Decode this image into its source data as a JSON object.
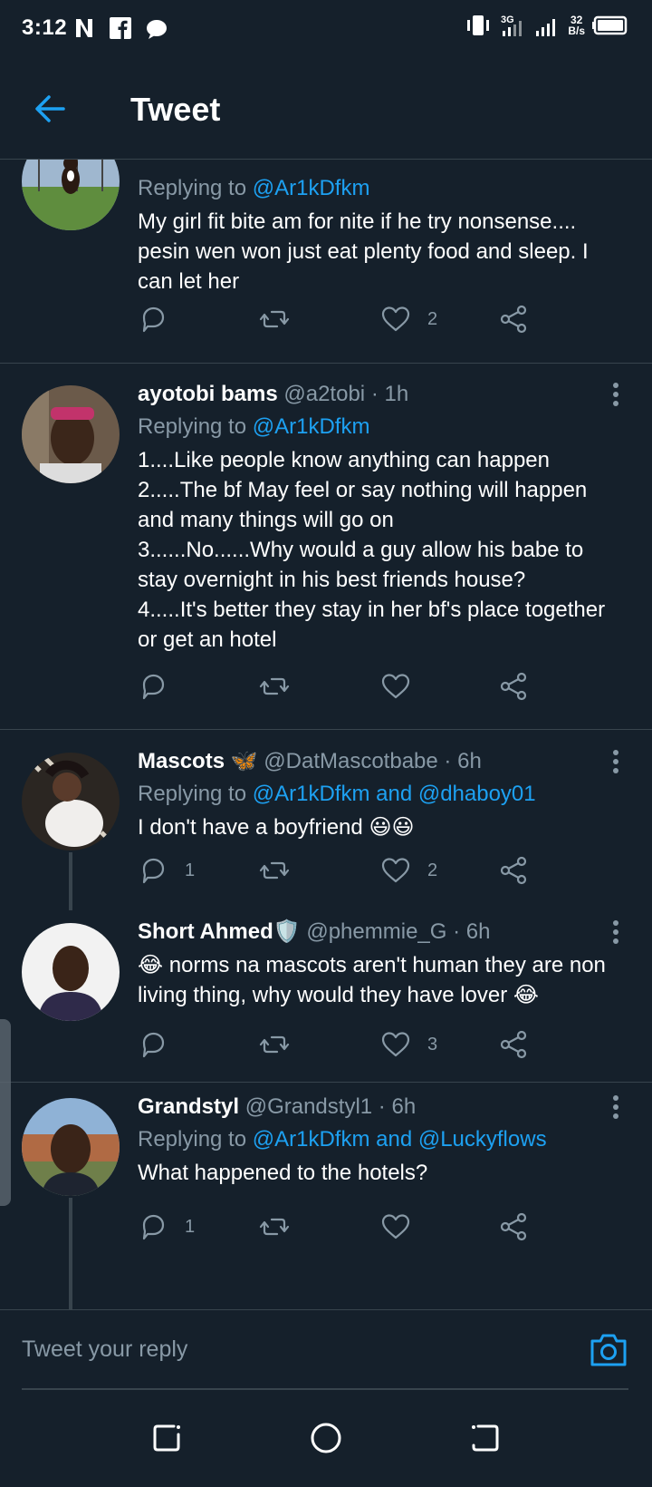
{
  "status_bar": {
    "time": "3:12",
    "net_speed_value": "32",
    "net_speed_unit": "B/s",
    "network_type": "3G"
  },
  "header": {
    "title": "Tweet"
  },
  "tweets": [
    {
      "reply_prefix": "Replying to ",
      "mentions": "@Ar1kDfkm",
      "text": "My girl fit bite am for nite if he try nonsense.... pesin wen won just eat plenty food and sleep. I can let her",
      "reply_count": "",
      "like_count": "2"
    },
    {
      "name": "ayotobi bams",
      "handle": "@a2tobi",
      "time": "1h",
      "reply_prefix": "Replying to ",
      "mentions": "@Ar1kDfkm",
      "lines": [
        "1....Like people know anything can happen",
        "2.....The bf May feel or say nothing will happen and many things will go on",
        "3......No......Why would a guy allow his babe to stay overnight in his best friends house?",
        "4.....It's better they stay in her bf's place together or get an hotel"
      ],
      "reply_count": "",
      "like_count": ""
    },
    {
      "name": "Mascots",
      "name_emoji": "🦋",
      "handle": "@DatMascotbabe",
      "time": "6h",
      "reply_prefix": "Replying to ",
      "mentions": "@Ar1kDfkm and @dhaboy01",
      "text": "I don't have a boyfriend",
      "text_emoji": "😃😃",
      "reply_count": "1",
      "like_count": "2"
    },
    {
      "name": "Short Ahmed",
      "name_emoji": "🛡️",
      "handle": "@phemmie_G",
      "time": "6h",
      "lead_emoji": "😂",
      "text": " norms na mascots aren't human they are non living thing, why would they have lover ",
      "trail_emoji": "😂",
      "reply_count": "",
      "like_count": "3"
    },
    {
      "name": "Grandstyl",
      "handle": "@Grandstyl1",
      "time": "6h",
      "reply_prefix": "Replying to ",
      "mentions": "@Ar1kDfkm and @Luckyflows",
      "text": "What happened to the hotels?",
      "reply_count": "1",
      "like_count": ""
    }
  ],
  "reply_bar": {
    "placeholder": "Tweet your reply"
  },
  "colors": {
    "background": "#15202b",
    "accent": "#1da1f2",
    "secondary_text": "#8899a6",
    "divider": "#38444d"
  }
}
